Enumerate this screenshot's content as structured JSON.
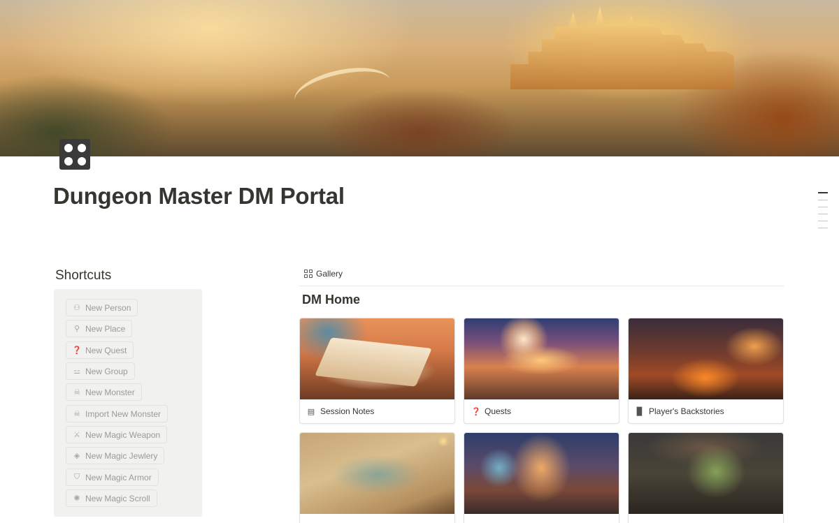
{
  "page": {
    "title": "Dungeon Master DM Portal",
    "cover_icon": "dice-six-icon",
    "cover_image": "fantasy-castle-valley-cover"
  },
  "shortcuts": {
    "title": "Shortcuts",
    "items": [
      {
        "label": "New Person",
        "icon": "person-add-icon",
        "glyph": "⚇"
      },
      {
        "label": "New Place",
        "icon": "map-pin-icon",
        "glyph": "⚲"
      },
      {
        "label": "New Quest",
        "icon": "speech-bubble-icon",
        "glyph": "❓"
      },
      {
        "label": "New Group",
        "icon": "group-icon",
        "glyph": "⚍"
      },
      {
        "label": "New Monster",
        "icon": "skull-icon",
        "glyph": "☠"
      },
      {
        "label": "Import New Monster",
        "icon": "skull-icon",
        "glyph": "☠"
      },
      {
        "label": "New Magic Weapon",
        "icon": "sword-icon",
        "glyph": "⚔"
      },
      {
        "label": "New Magic Jewlery",
        "icon": "gem-icon",
        "glyph": "◈"
      },
      {
        "label": "New Magic Armor",
        "icon": "shield-icon",
        "glyph": "⛉"
      },
      {
        "label": "New Magic Scroll",
        "icon": "sparkle-icon",
        "glyph": "✺"
      }
    ]
  },
  "gallery": {
    "view_tab": "Gallery",
    "section_title": "DM Home",
    "cards": [
      {
        "label": "Session Notes",
        "icon": "page-icon",
        "glyph": "▤",
        "image": "open-book-desk-image"
      },
      {
        "label": "Quests",
        "icon": "speech-bubble-icon",
        "glyph": "❓",
        "image": "planet-sunset-landscape-image"
      },
      {
        "label": "Player's Backstories",
        "icon": "book-icon",
        "glyph": "▉",
        "image": "burning-village-image"
      },
      {
        "label": "",
        "icon": "",
        "glyph": "",
        "image": "fantasy-map-image"
      },
      {
        "label": "",
        "icon": "",
        "glyph": "",
        "image": "adventuring-party-image"
      },
      {
        "label": "",
        "icon": "",
        "glyph": "",
        "image": "troll-monster-image"
      }
    ]
  }
}
